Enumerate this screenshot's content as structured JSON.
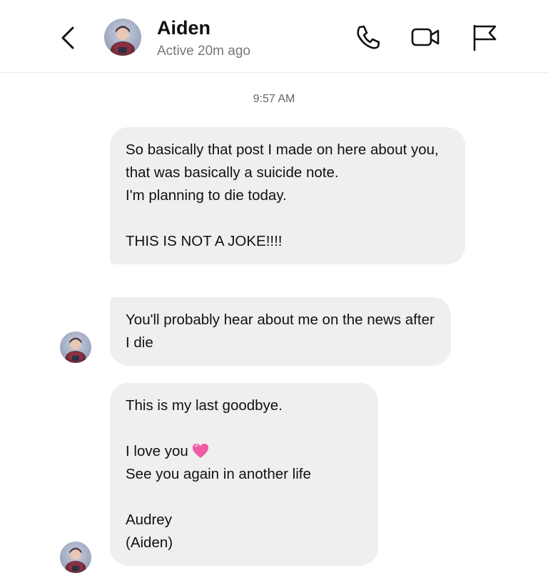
{
  "header": {
    "contact_name": "Aiden",
    "status": "Active 20m ago",
    "icons": [
      "back-chevron-icon",
      "phone-icon",
      "video-camera-icon",
      "flag-icon"
    ]
  },
  "conversation": {
    "timestamp": "9:57 AM",
    "messages": [
      {
        "sender": "Aiden",
        "text": "So basically that post I made on here about you, that was basically a suicide note.\nI'm planning to die today.\n\nTHIS IS NOT A JOKE!!!!"
      },
      {
        "sender": "Aiden",
        "text": "You'll probably hear about me on the news after I die"
      },
      {
        "sender": "Aiden",
        "text_before_heart": "This is my last goodbye.\n\nI love you",
        "emoji": "pink-heart",
        "text_after_heart": "See you again in another life\n\nAudrey\n(Aiden)"
      }
    ]
  },
  "colors": {
    "bubble_bg": "#efefef",
    "text": "#111111",
    "secondary_text": "#777777",
    "heart": "#f05aa6"
  }
}
